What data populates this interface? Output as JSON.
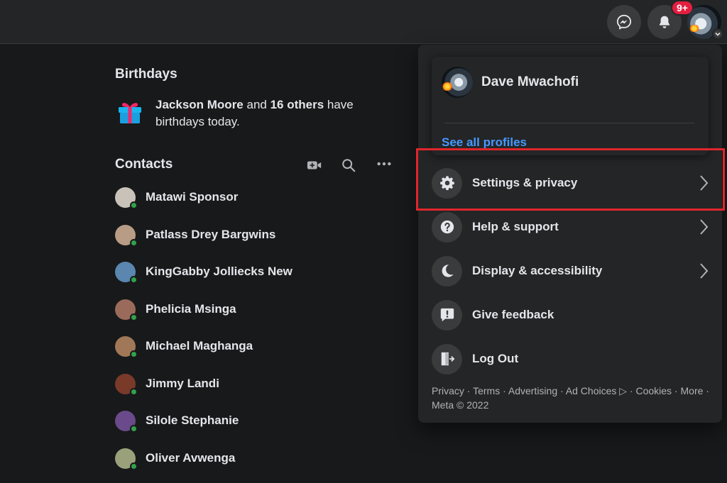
{
  "topbar": {
    "notification_badge": "9+"
  },
  "birthdays": {
    "title": "Birthdays",
    "name": "Jackson Moore",
    "and": " and ",
    "others": "16 others",
    "tail": " have birthdays today."
  },
  "contacts": {
    "title": "Contacts",
    "items": [
      {
        "name": "Matawi Sponsor",
        "color": "#c9c2b8"
      },
      {
        "name": "Patlass Drey Bargwins",
        "color": "#b89c86"
      },
      {
        "name": "KingGabby Jolliecks New",
        "color": "#5a86b0"
      },
      {
        "name": "Phelicia Msinga",
        "color": "#9a6a5a"
      },
      {
        "name": "Michael Maghanga",
        "color": "#a07858"
      },
      {
        "name": "Jimmy Landi",
        "color": "#7a3a2a"
      },
      {
        "name": "Silole Stephanie",
        "color": "#6a4a8a"
      },
      {
        "name": "Oliver Avwenga",
        "color": "#9aa07a"
      }
    ]
  },
  "menu": {
    "profile_name": "Dave Mwachofi",
    "see_all_profiles": "See all profiles",
    "items": [
      {
        "label": "Settings & privacy",
        "icon": "gear-icon"
      },
      {
        "label": "Help & support",
        "icon": "question-icon"
      },
      {
        "label": "Display & accessibility",
        "icon": "moon-icon"
      },
      {
        "label": "Give feedback",
        "icon": "feedback-icon"
      },
      {
        "label": "Log Out",
        "icon": "logout-icon"
      }
    ],
    "footer": "Privacy · Terms · Advertising · Ad Choices ▷ · Cookies · More · Meta © 2022"
  },
  "colors": {
    "background": "#18191a",
    "surface": "#242526",
    "accent_link": "#4599ff",
    "highlight_box": "#e0262c",
    "online": "#31a24c"
  }
}
